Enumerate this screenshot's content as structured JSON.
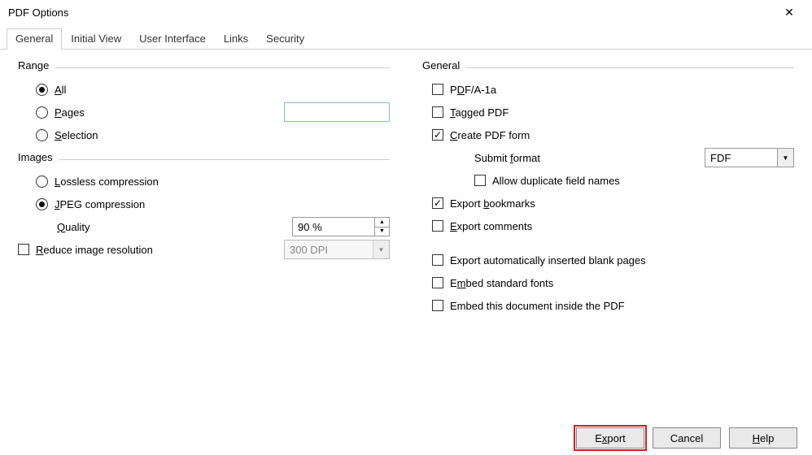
{
  "window": {
    "title": "PDF Options"
  },
  "tabs": [
    "General",
    "Initial View",
    "User Interface",
    "Links",
    "Security"
  ],
  "active_tab": 0,
  "range": {
    "header": "Range",
    "all": "All",
    "pages": "Pages",
    "selection": "Selection",
    "pages_value": "",
    "selected": "all"
  },
  "images": {
    "header": "Images",
    "lossless": "Lossless compression",
    "jpeg": "JPEG compression",
    "selected": "jpeg",
    "quality_label": "Quality",
    "quality_value": "90 %",
    "reduce_label": "Reduce image resolution",
    "reduce_checked": false,
    "dpi_value": "300 DPI"
  },
  "general": {
    "header": "General",
    "pdfa": "PDF/A-1a",
    "pdfa_checked": false,
    "tagged": "Tagged PDF",
    "tagged_checked": false,
    "create_form": "Create PDF form",
    "create_form_checked": true,
    "submit_format_label": "Submit format",
    "submit_format_value": "FDF",
    "allow_dup": "Allow duplicate field names",
    "allow_dup_checked": false,
    "export_bookmarks": "Export bookmarks",
    "export_bookmarks_checked": true,
    "export_comments": "Export comments",
    "export_comments_checked": false,
    "blank_pages": "Export automatically inserted blank pages",
    "blank_pages_checked": false,
    "embed_fonts": "Embed standard fonts",
    "embed_fonts_checked": false,
    "embed_doc": "Embed this document inside the PDF",
    "embed_doc_checked": false
  },
  "buttons": {
    "export": "Export",
    "cancel": "Cancel",
    "help": "Help"
  }
}
